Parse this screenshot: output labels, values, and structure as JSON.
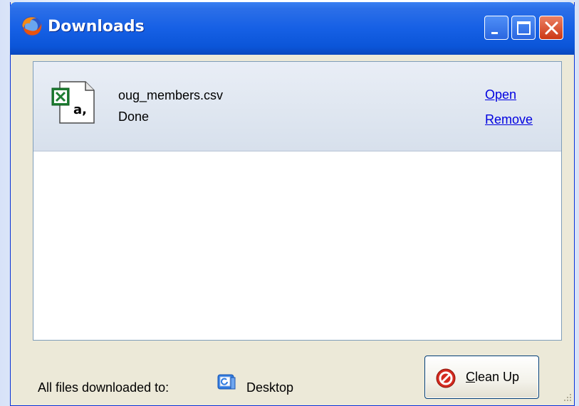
{
  "window": {
    "title": "Downloads",
    "icon": "firefox-icon",
    "controls": [
      "minimize-icon",
      "maximize-icon",
      "close-icon"
    ]
  },
  "downloads": [
    {
      "file_name": "oug_members.csv",
      "status": "Done",
      "icon": "csv-file-icon",
      "actions": {
        "open": "Open",
        "remove": "Remove"
      }
    }
  ],
  "footer": {
    "label": "All files downloaded to:",
    "folder_icon": "folder-icon",
    "folder_name": "Desktop",
    "cleanup_label_prefix": "C",
    "cleanup_label_rest": "lean Up",
    "cleanup_icon": "stop-icon"
  },
  "colors": {
    "titlebar": "#1660e5",
    "link": "#0000e0",
    "item_bg": "#d7e0ec",
    "window_bg": "#ece9d8"
  }
}
